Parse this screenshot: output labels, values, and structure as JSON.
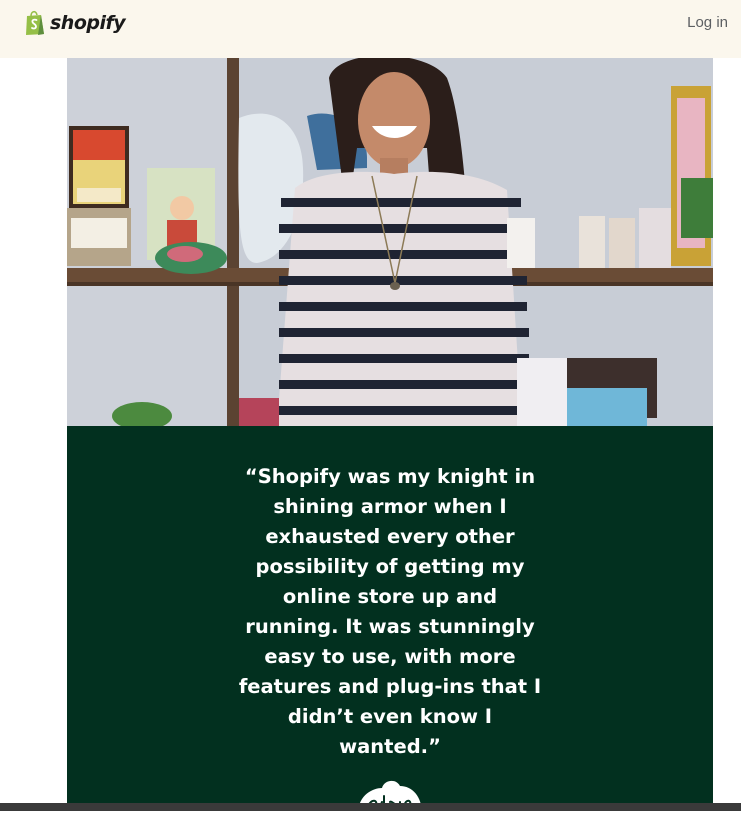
{
  "header": {
    "brand_name": "shopify",
    "login_label": "Log in",
    "brand_color": "#95bf47"
  },
  "hero": {
    "image_subject": "woman-in-striped-shirt-in-front-of-shelves"
  },
  "testimonial": {
    "quote_lines": [
      "“Shopify was my knight in",
      "shining armor when I",
      "exhausted every other",
      "possibility of getting my",
      "online store up and",
      "running. It was stunningly",
      "easy to use, with more",
      "features and plug-ins that I",
      "didn’t even know I",
      "wanted.”"
    ],
    "signature": "alicia",
    "panel_color": "#02301f"
  }
}
